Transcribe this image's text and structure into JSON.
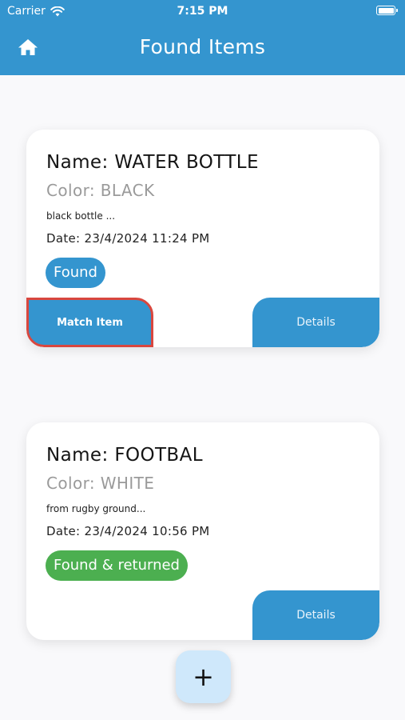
{
  "status_bar": {
    "carrier": "Carrier",
    "time": "7:15 PM",
    "icons": [
      "wifi-icon",
      "battery-icon"
    ]
  },
  "app_bar": {
    "title": "Found Items",
    "home_icon": "home-icon",
    "background_color": "#3495cf"
  },
  "items": [
    {
      "name": "Name: WATER BOTTLE",
      "color": "Color: BLACK",
      "description": "black bottle ...",
      "date": "Date:  23/4/2024 11:24 PM",
      "status": "Found",
      "status_color": "#3495cf",
      "match_label": "Match Item",
      "details_label": "Details"
    },
    {
      "name": "Name: FOOTBAL",
      "color": "Color: WHITE",
      "description": "from rugby ground...",
      "date": "Date:  23/4/2024 10:56 PM",
      "status": "Found & returned",
      "status_color": "#4caf50",
      "details_label": "Details"
    }
  ],
  "fab": {
    "label": "+",
    "icon": "plus-icon"
  },
  "accent_color": "#3495cf",
  "highlight_border_color": "#d9473f"
}
